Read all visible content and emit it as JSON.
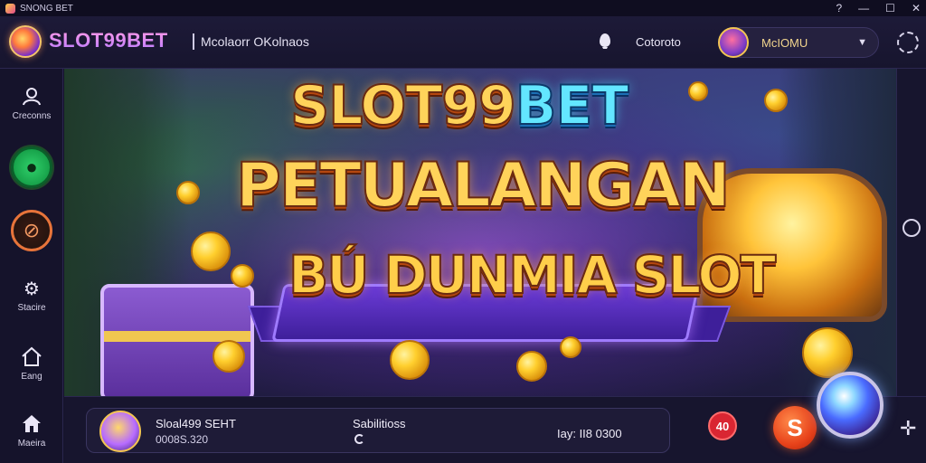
{
  "window": {
    "title": "SNONG BET",
    "controls": [
      "?",
      "—",
      "☐",
      "✕"
    ]
  },
  "header": {
    "brand": "SLOT99BET",
    "subtitle": "Mcolaorr OKolnaos",
    "label": "Cotoroto",
    "user_name": "McIOMU"
  },
  "sidebar": {
    "items": [
      {
        "label": "Creconns",
        "icon": "user-icon"
      },
      {
        "label": "",
        "icon": "pouch-icon"
      },
      {
        "label": "",
        "icon": "no-sign-icon"
      },
      {
        "label": "Stacire",
        "icon": "gear-icon"
      },
      {
        "label": "Eang",
        "icon": "home-icon"
      },
      {
        "label": "Maeira",
        "icon": "house-icon"
      }
    ]
  },
  "banner": {
    "line1_a": "SLOT99",
    "line1_b": "BET",
    "line2": "PETUALANGAN",
    "line3": "BÚ DUNMIA SLOT"
  },
  "bottom": {
    "name": "Sloal499 SEHT",
    "amount": "0008S.320",
    "label": "Sabilitioss",
    "value": "Iay: II8 0300",
    "badge": "40",
    "spin_glyph": "S"
  },
  "colors": {
    "accent_gold": "#ffd35a",
    "accent_purple": "#6b3bd6",
    "badge_red": "#d92632",
    "spin_orange": "#e8431b"
  }
}
